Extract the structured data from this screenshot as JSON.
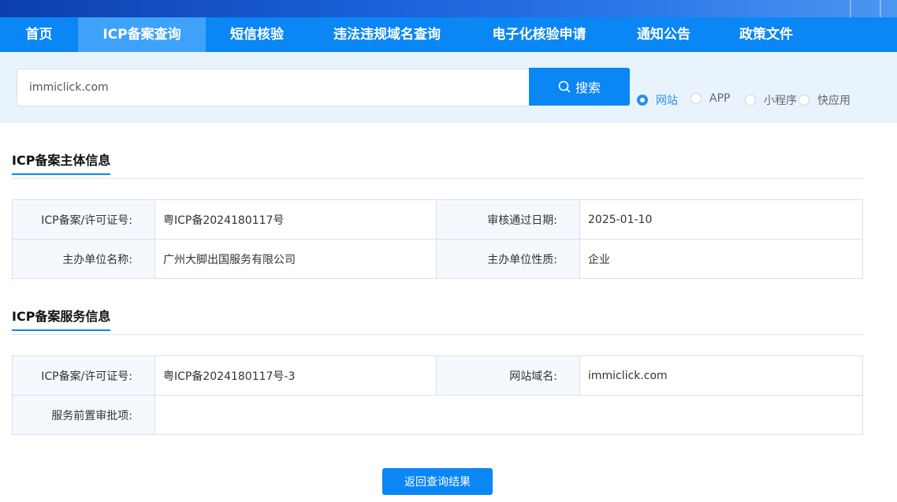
{
  "nav": {
    "items": [
      {
        "label": "首页"
      },
      {
        "label": "ICP备案查询"
      },
      {
        "label": "短信核验"
      },
      {
        "label": "违法违规域名查询"
      },
      {
        "label": "电子化核验申请"
      },
      {
        "label": "通知公告"
      },
      {
        "label": "政策文件"
      }
    ],
    "active": "ICP备案查询"
  },
  "search": {
    "value": "immiclick.com",
    "button_label": "搜索",
    "button_icon": "search-icon"
  },
  "filter": {
    "options": [
      {
        "label": "网站",
        "checked": true
      },
      {
        "label": "APP",
        "checked": false
      },
      {
        "label": "小程序",
        "checked": false
      },
      {
        "label": "快应用",
        "checked": false
      }
    ]
  },
  "subject_section": {
    "title": "ICP备案主体信息",
    "rows": [
      {
        "label1": "ICP备案/许可证号:",
        "value1": "粤ICP备2024180117号",
        "label2": "审核通过日期:",
        "value2": "2025-01-10"
      },
      {
        "label1": "主办单位名称:",
        "value1": "广州大脚出国服务有限公司",
        "label2": "主办单位性质:",
        "value2": "企业"
      }
    ]
  },
  "service_section": {
    "title": "ICP备案服务信息",
    "row1": {
      "label1": "ICP备案/许可证号:",
      "value1": "粤ICP备2024180117号-3",
      "label2": "网站域名:",
      "value2": "immiclick.com"
    },
    "row2": {
      "label": "服务前置审批项:",
      "value": ""
    }
  },
  "back_button": {
    "label": "返回查询结果"
  },
  "colors": {
    "primary": "#0a86f5",
    "nav_active": "#3ea2f9",
    "search_band": "#e9f3fd",
    "radio_checked": "#2d8cf0"
  }
}
